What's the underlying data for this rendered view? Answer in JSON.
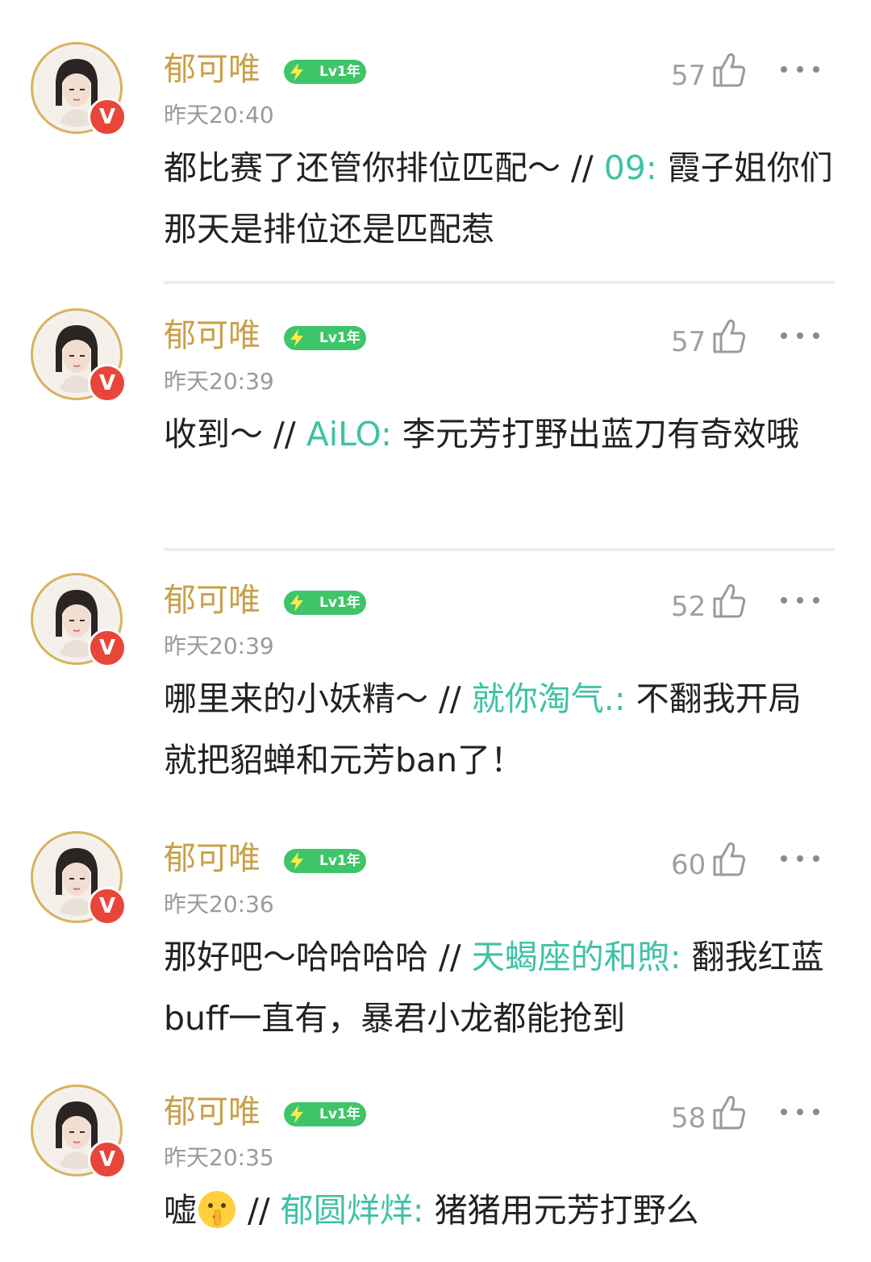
{
  "comments": [
    {
      "username": "郁可唯",
      "level_badge": "Lv1年",
      "timestamp": "昨天20:40",
      "likes": "57",
      "reply_text": "都比赛了还管你排位匹配～ // ",
      "mention": "09:",
      "quoted_text": " 霞子姐你们那天是排位还是匹配惹"
    },
    {
      "username": "郁可唯",
      "level_badge": "Lv1年",
      "timestamp": "昨天20:39",
      "likes": "57",
      "reply_text": "收到～ // ",
      "mention": "AiLO:",
      "quoted_text": " 李元芳打野出蓝刀有奇效哦"
    },
    {
      "username": "郁可唯",
      "level_badge": "Lv1年",
      "timestamp": "昨天20:39",
      "likes": "52",
      "reply_text": "哪里来的小妖精～ // ",
      "mention": "就你淘气.:",
      "quoted_text": " 不翻我开局就把貂蝉和元芳ban了！"
    },
    {
      "username": "郁可唯",
      "level_badge": "Lv1年",
      "timestamp": "昨天20:36",
      "likes": "60",
      "reply_text": "那好吧～哈哈哈哈 // ",
      "mention": "天蝎座的和煦:",
      "quoted_text": " 翻我红蓝buff一直有，暴君小龙都能抢到"
    },
    {
      "username": "郁可唯",
      "level_badge": "Lv1年",
      "timestamp": "昨天20:35",
      "likes": "58",
      "reply_text": "嘘",
      "emoji": "shushing-face-emoji",
      "reply_text_after": " // ",
      "mention": "郁圆烊烊:",
      "quoted_text": " 猪猪用元芳打野么"
    }
  ],
  "verified_badge_label": "V",
  "icons": {
    "like": "thumbs-up-icon",
    "more": "more-dots-icon",
    "level": "lightning-icon"
  },
  "colors": {
    "username": "#c9a04a",
    "mention": "#3ec2a5",
    "level_badge": "#3ec569",
    "verified_badge": "#e8463a",
    "timestamp": "#9a9a9a"
  }
}
